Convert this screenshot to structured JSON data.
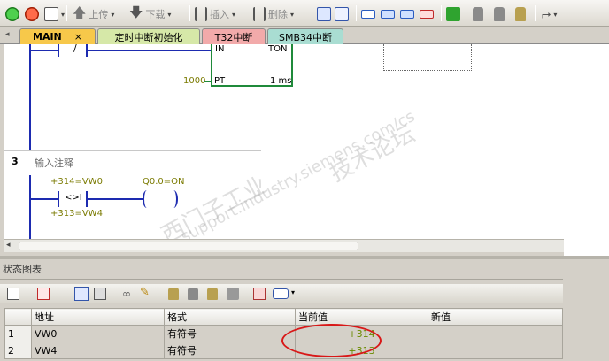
{
  "toolbar": {
    "upload_label": "上传",
    "download_label": "下载",
    "insert_label": "插入",
    "delete_label": "删除"
  },
  "tabs": [
    {
      "label": "MAIN",
      "color": "#f7c84a"
    },
    {
      "label": "定时中断初始化",
      "color": "#d6e8a8"
    },
    {
      "label": "T32中断",
      "color": "#f2aaaa"
    },
    {
      "label": "SMB34中断",
      "color": "#a9ddd2"
    }
  ],
  "network2": {
    "contact_symbol": "/",
    "timer_in": "IN",
    "timer_type": "TON",
    "pt_value": "1000",
    "pt_label": "PT",
    "time_base": "1 ms"
  },
  "network3": {
    "number": "3",
    "comment": "输入注释",
    "top_operand": "+314=VW0",
    "compare_op": "<>I",
    "bottom_operand": "+313=VW4",
    "coil_operand": "Q0.0=ON"
  },
  "watermark": {
    "line1": "西门子工业",
    "line2": "技术论坛",
    "line3": "support.industry.siemens.com/cs"
  },
  "status_chart": {
    "title": "状态图表",
    "columns": [
      "",
      "地址",
      "格式",
      "当前值",
      "新值"
    ],
    "rows": [
      {
        "index": "1",
        "address": "VW0",
        "format": "有符号",
        "current": "+314",
        "new": ""
      },
      {
        "index": "2",
        "address": "VW4",
        "format": "有符号",
        "current": "+313",
        "new": ""
      }
    ]
  },
  "colors": {
    "ladder_wire": "#1d2bb0",
    "value_green": "#6a8a00",
    "highlight_ellipse": "#d81818",
    "operand_olive": "#7a7a00"
  }
}
